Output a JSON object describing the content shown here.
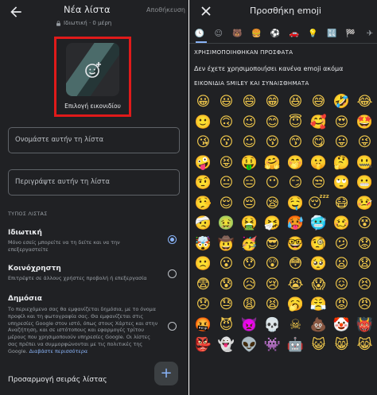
{
  "left": {
    "header": {
      "title": "Νέα λίστα",
      "save": "Αποθήκευση",
      "subtitle": "Ιδιωτική · 0 μέρη"
    },
    "cover": {
      "label": "Επιλογή εικονιδίου"
    },
    "fields": {
      "name_placeholder": "Ονομάστε αυτήν τη λίστα",
      "desc_placeholder": "Περιγράψτε αυτήν τη λίστα"
    },
    "section_label": "ΤΥΠΟΣ ΛΙΣΤΑΣ",
    "options": [
      {
        "title": "Ιδιωτική",
        "desc": "Μόνο εσείς μπορείτε να τη δείτε και να την επεξεργαστείτε",
        "selected": true
      },
      {
        "title": "Κοινόχρηστη",
        "desc": "Επιτρέψτε σε άλλους χρήστες προβολή ή επεξεργασία",
        "selected": false
      },
      {
        "title": "Δημόσια",
        "desc": "Το περιεχόμενο σας θα εμφανίζεται δημόσια, με το όνομα προφίλ και τη φωτογραφία σας. Θα εμφανίζεται στις υπηρεσίες Google στον ιστό, όπως στους Χάρτες και στην Αναζήτηση, και σε ιστότοπους και εφαρμογές τρίτου μέρους που χρησιμοποιούν υπηρεσίες Google. Οι λίστες σας πρέπει να συμμορφώνονται με τις πολιτικές της Google.",
        "link": "Διαβάστε περισσότερα",
        "selected": false
      }
    ],
    "sort_label": "Προσαρμογή σειράς λίστας",
    "fab": "+"
  },
  "right": {
    "header": {
      "title": "Προσθήκη emoji",
      "close": "✕"
    },
    "tabs": [
      "🕓",
      "☺",
      "🐻",
      "🍔",
      "⚽",
      "🚗",
      "💡",
      "🔣",
      "🏁",
      "✈"
    ],
    "recent_label": "ΧΡΗΣΙΜΟΠΟΙΗΘΗΚΑΝ ΠΡΟΣΦΑΤΑ",
    "recent_empty": "Δεν έχετε χρησιμοποιήσει κανένα emoji ακόμα",
    "smileys_label": "ΕΙΚΟΝΙΔΙΑ SMILEY ΚΑΙ ΣΥΝΑΙΣΘΗΜΑΤΑ",
    "emojis": [
      "😀",
      "😃",
      "😄",
      "😁",
      "😆",
      "😅",
      "🤣",
      "😂",
      "🙂",
      "🙃",
      "😉",
      "😊",
      "😇",
      "🥰",
      "😍",
      "🤩",
      "😘",
      "😗",
      "☺",
      "😚",
      "😙",
      "😋",
      "😛",
      "😜",
      "🤪",
      "😝",
      "🤑",
      "🤗",
      "🤭",
      "🤫",
      "🤔",
      "🤐",
      "🤨",
      "😐",
      "😑",
      "😶",
      "😏",
      "😒",
      "🙄",
      "😬",
      "🤥",
      "😌",
      "😔",
      "😪",
      "🤤",
      "😴",
      "😷",
      "🤒",
      "🤕",
      "🤢",
      "🤮",
      "🤧",
      "🥵",
      "🥶",
      "🥴",
      "😵",
      "🤯",
      "🤠",
      "🥳",
      "😎",
      "🤓",
      "🧐",
      "😕",
      "😟",
      "🙁",
      "😮",
      "😯",
      "😲",
      "😳",
      "🥺",
      "😦",
      "😧",
      "😨",
      "😰",
      "😥",
      "😢",
      "😭",
      "😱",
      "😖",
      "😣",
      "😞",
      "😓",
      "😩",
      "😫",
      "🥱",
      "😤",
      "😡",
      "😠",
      "🤬",
      "😈",
      "👿",
      "💀",
      "☠",
      "💩",
      "🤡",
      "👹",
      "👺",
      "👻",
      "👽",
      "👾",
      "🤖",
      "😺",
      "😸",
      "😹"
    ]
  }
}
